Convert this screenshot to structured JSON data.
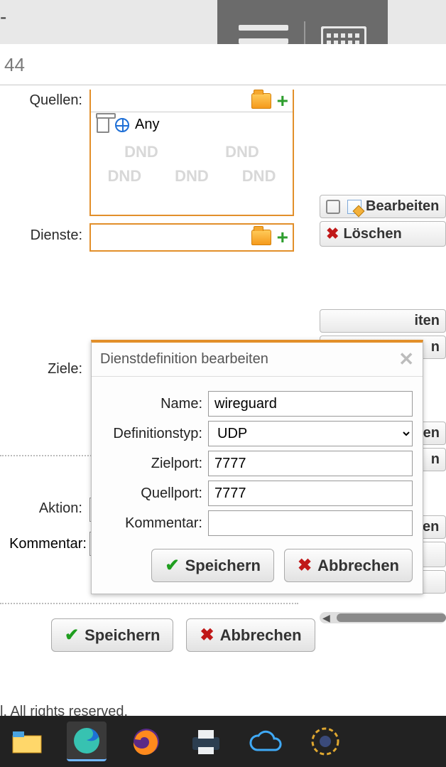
{
  "url_fragment": "44",
  "header_dash": "-",
  "labels": {
    "quellen": "Quellen:",
    "dienste": "Dienste:",
    "ziele": "Ziele:",
    "aktion": "Aktion:",
    "kommentar": "Kommentar:"
  },
  "quellen_box": {
    "any": "Any",
    "dnd": "DND"
  },
  "side": {
    "bearbeiten": "Bearbeiten",
    "loeschen": "Löschen",
    "klonen": "Klonen",
    "iten": "iten",
    "n": "n"
  },
  "dialog": {
    "title": "Dienstdefinition bearbeiten",
    "name_label": "Name:",
    "name_value": "wireguard",
    "deftyp_label": "Definitionstyp:",
    "deftyp_value": "UDP",
    "zielport_label": "Zielport:",
    "zielport_value": "7777",
    "quellport_label": "Quellport:",
    "quellport_value": "7777",
    "kommentar_label": "Kommentar:",
    "kommentar_value": "",
    "save": "Speichern",
    "cancel": "Abbrechen"
  },
  "page_buttons": {
    "save": "Speichern",
    "cancel": "Abbrechen"
  },
  "footer": "l. All rights reserved."
}
